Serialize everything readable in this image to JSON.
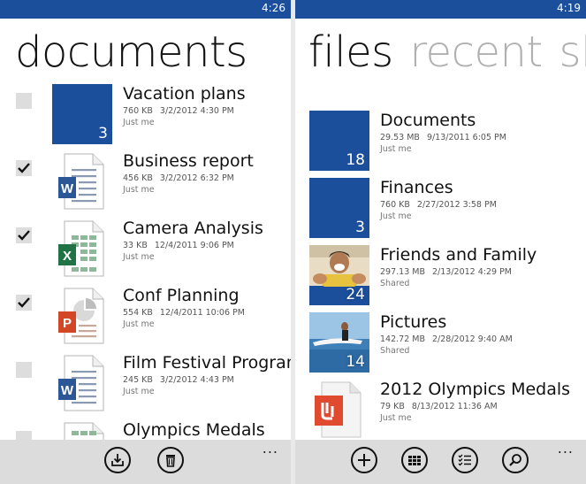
{
  "left": {
    "time": "4:26",
    "title": "documents",
    "items": [
      {
        "name": "Vacation plans",
        "size": "760 KB",
        "date": "3/2/2012 4:30 PM",
        "sub": "Just me",
        "count": "3",
        "checked": false,
        "icon": "folder-tile"
      },
      {
        "name": "Business report",
        "size": "456 KB",
        "date": "3/2/2012 6:32 PM",
        "sub": "Just me",
        "checked": true,
        "icon": "word-doc-icon"
      },
      {
        "name": "Camera Analysis",
        "size": "33 KB",
        "date": "12/4/2011 9:06 PM",
        "sub": "Just me",
        "checked": true,
        "icon": "excel-doc-icon"
      },
      {
        "name": "Conf Planning",
        "size": "554 KB",
        "date": "12/4/2011 10:06 PM",
        "sub": "Just me",
        "checked": true,
        "icon": "powerpoint-doc-icon"
      },
      {
        "name": "Film Festival Program",
        "size": "245 KB",
        "date": "3/2/2012 4:43 PM",
        "sub": "Just me",
        "checked": false,
        "icon": "word-doc-icon"
      },
      {
        "name": "Olympics Medals",
        "checked": false,
        "icon": "excel-doc-icon"
      }
    ],
    "appbar": {
      "buttons": [
        "download-icon",
        "delete-icon"
      ],
      "more": "..."
    }
  },
  "right": {
    "time": "4:19",
    "pivot": [
      "files",
      "recent",
      "sha"
    ],
    "items": [
      {
        "name": "Documents",
        "size": "29.53 MB",
        "date": "9/13/2011 6:05 PM",
        "sub": "Just me",
        "count": "18",
        "icon": "folder-tile"
      },
      {
        "name": "Finances",
        "size": "760 KB",
        "date": "2/27/2012 3:58 PM",
        "sub": "Just me",
        "count": "3",
        "icon": "folder-tile"
      },
      {
        "name": "Friends and Family",
        "size": "297.13 MB",
        "date": "2/13/2012 4:29 PM",
        "sub": "Shared",
        "count": "24",
        "icon": "photo-folder-tile"
      },
      {
        "name": "Pictures",
        "size": "142.72 MB",
        "date": "2/28/2012 9:40 AM",
        "sub": "Shared",
        "count": "14",
        "icon": "photo-folder-tile"
      },
      {
        "name": "2012 Olympics Medals",
        "size": "79 KB",
        "date": "8/13/2012 11:36 AM",
        "sub": "Just me",
        "icon": "pdf-doc-icon"
      }
    ],
    "appbar": {
      "buttons": [
        "add-icon",
        "view-tiles-icon",
        "select-list-icon",
        "search-icon"
      ],
      "more": "..."
    }
  },
  "colors": {
    "accent": "#1b4f9c",
    "word": "#2b5797",
    "excel": "#217346",
    "powerpoint": "#d24726",
    "pdf": "#e04a2f",
    "appbar": "#dcdcdc"
  }
}
